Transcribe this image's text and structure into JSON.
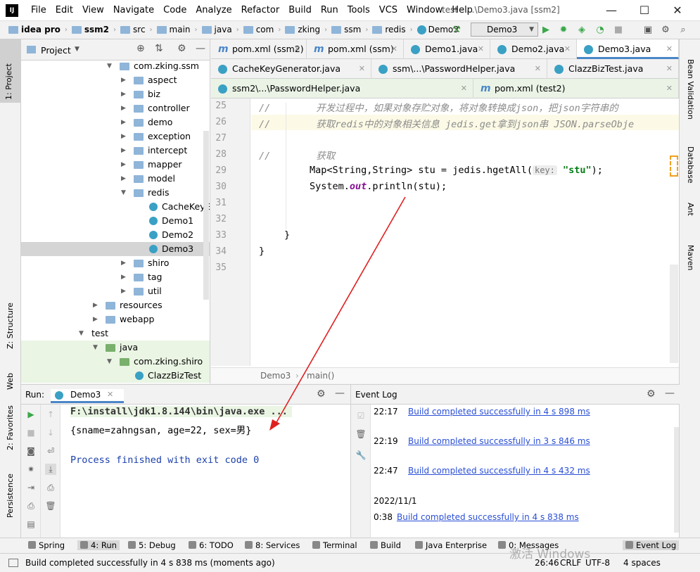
{
  "window": {
    "menu": [
      "File",
      "Edit",
      "View",
      "Navigate",
      "Code",
      "Analyze",
      "Refactor",
      "Build",
      "Run",
      "Tools",
      "VCS",
      "Window",
      "Help"
    ],
    "title": "test - ...\\Demo3.java [ssm2]",
    "logo": "IJ"
  },
  "navbar": {
    "crumbs": [
      "idea pro",
      "ssm2",
      "src",
      "main",
      "java",
      "com",
      "zking",
      "ssm",
      "redis",
      "Demo3"
    ],
    "run_config": "Demo3"
  },
  "left_strip": [
    "1: Project",
    "Z: Structure",
    "Web",
    "2: Favorites",
    "Persistence"
  ],
  "right_strip": [
    "Bean Validation",
    "Database",
    "Ant",
    "Maven"
  ],
  "project": {
    "title": "Project",
    "tree": [
      {
        "label": "com.zking.ssm",
        "depth": 2,
        "kind": "package",
        "open": true
      },
      {
        "label": "aspect",
        "depth": 3,
        "kind": "folder",
        "open": false
      },
      {
        "label": "biz",
        "depth": 3,
        "kind": "folder",
        "open": false
      },
      {
        "label": "controller",
        "depth": 3,
        "kind": "folder",
        "open": false
      },
      {
        "label": "demo",
        "depth": 3,
        "kind": "folder",
        "open": false
      },
      {
        "label": "exception",
        "depth": 3,
        "kind": "folder",
        "open": false
      },
      {
        "label": "intercept",
        "depth": 3,
        "kind": "folder",
        "open": false
      },
      {
        "label": "mapper",
        "depth": 3,
        "kind": "folder",
        "open": false
      },
      {
        "label": "model",
        "depth": 3,
        "kind": "folder",
        "open": false
      },
      {
        "label": "redis",
        "depth": 3,
        "kind": "folder",
        "open": true
      },
      {
        "label": "CacheKeyGenerator",
        "depth": 4,
        "kind": "class"
      },
      {
        "label": "Demo1",
        "depth": 4,
        "kind": "class"
      },
      {
        "label": "Demo2",
        "depth": 4,
        "kind": "class"
      },
      {
        "label": "Demo3",
        "depth": 4,
        "kind": "class",
        "selected": true
      },
      {
        "label": "shiro",
        "depth": 3,
        "kind": "folder",
        "open": false
      },
      {
        "label": "tag",
        "depth": 3,
        "kind": "folder",
        "open": false
      },
      {
        "label": "util",
        "depth": 3,
        "kind": "folder",
        "open": false
      },
      {
        "label": "resources",
        "depth": 1,
        "kind": "folder",
        "open": false
      },
      {
        "label": "webapp",
        "depth": 1,
        "kind": "folder",
        "open": false
      },
      {
        "label": "test",
        "depth": 0,
        "kind": "plain",
        "open": true
      },
      {
        "label": "java",
        "depth": 1,
        "kind": "folder",
        "open": true,
        "green": true
      },
      {
        "label": "com.zking.shiro",
        "depth": 2,
        "kind": "package",
        "open": true,
        "green": true
      },
      {
        "label": "ClazzBizTest",
        "depth": 3,
        "kind": "class",
        "green": true
      }
    ]
  },
  "editor": {
    "tabs_row1": [
      {
        "label": "pom.xml (ssm2)",
        "icon": "m"
      },
      {
        "label": "pom.xml (ssm)",
        "icon": "m"
      },
      {
        "label": "Demo1.java",
        "icon": "c"
      },
      {
        "label": "Demo2.java",
        "icon": "c"
      },
      {
        "label": "Demo3.java",
        "icon": "c",
        "active": true
      }
    ],
    "tabs_row2": [
      {
        "label": "CacheKeyGenerator.java",
        "icon": "c"
      },
      {
        "label": "ssm\\...\\PasswordHelper.java",
        "icon": "c"
      },
      {
        "label": "ClazzBizTest.java",
        "icon": "c"
      }
    ],
    "tabs_row3": [
      {
        "label": "ssm2\\...\\PasswordHelper.java",
        "icon": "c"
      },
      {
        "label": "pom.xml (test2)",
        "icon": "m"
      }
    ],
    "line_numbers": [
      "25",
      "26",
      "27",
      "28",
      "29",
      "30",
      "31",
      "32",
      "33",
      "34",
      "35"
    ],
    "code": {
      "l25": "//        开发过程中，如果对象存贮对象，将对象转换成json，把json字符串的",
      "l26": "//        获取redis中的对象相关信息 jedis.get拿到json串 JSON.parseObje",
      "l28": "//        获取",
      "l29a": "Map<String,String> stu = jedis.hgetAll(",
      "l29hint": "key:",
      "l29str": "\"stu\"",
      "l29b": ");",
      "l30a": "System.",
      "l30out": "out",
      "l30b": ".println(stu);",
      "l33": "}",
      "l34": "}"
    },
    "crumb": [
      "Demo3",
      "main()"
    ]
  },
  "run": {
    "label": "Run:",
    "tab": "Demo3",
    "lines": [
      "F:\\install\\jdk1.8.144\\bin\\java.exe ...",
      "{sname=zahngsan, age=22, sex=男}",
      "",
      "Process finished with exit code 0"
    ]
  },
  "event_log": {
    "title": "Event Log",
    "entries": [
      {
        "time": "22:17",
        "msg": "Build completed successfully in 4 s 898 ms"
      },
      {
        "time": "22:19",
        "msg": "Build completed successfully in 3 s 846 ms"
      },
      {
        "time": "22:47",
        "msg": "Build completed successfully in 4 s 432 ms"
      },
      {
        "date": "2022/11/1",
        "time": "0:38",
        "msg": "Build completed successfully in 4 s 838 ms"
      }
    ]
  },
  "bottom_tools": [
    "Spring",
    "4: Run",
    "5: Debug",
    "6: TODO",
    "8: Services",
    "Terminal",
    "Build",
    "Java Enterprise",
    "0: Messages",
    "Event Log"
  ],
  "status": {
    "message": "Build completed successfully in 4 s 838 ms (moments ago)",
    "position": "26:46",
    "line_sep": "CRLF",
    "encoding": "UTF-8",
    "indent": "4 spaces"
  },
  "watermark": "激活 Windows",
  "colors": {
    "accent": "#4a86c8",
    "link": "#2a4fd6",
    "arrow": "#e02020",
    "green_row": "#eaf5e4",
    "selected_row": "#d5d5d5"
  }
}
